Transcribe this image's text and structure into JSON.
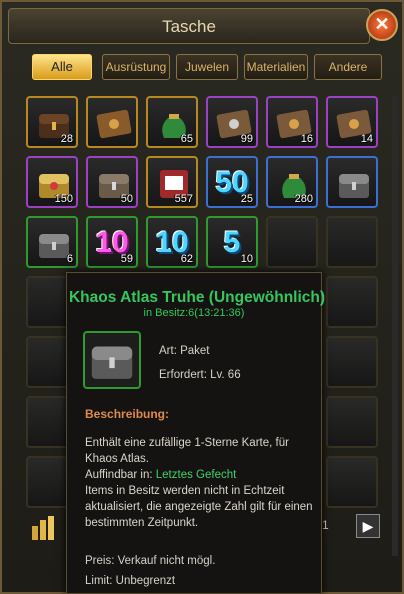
{
  "window": {
    "title": "Tasche",
    "close_symbol": "✕"
  },
  "tabs": [
    {
      "label": "Alle",
      "active": true
    },
    {
      "label": "Ausrüstung",
      "active": false
    },
    {
      "label": "Juwelen",
      "active": false
    },
    {
      "label": "Materialien",
      "active": false
    },
    {
      "label": "Andere",
      "active": false
    }
  ],
  "inventory": {
    "rows": [
      [
        {
          "icon": "treasure-chest-icon",
          "quality": "gold",
          "count": "28"
        },
        {
          "icon": "card-pack-icon",
          "quality": "gold",
          "count": ""
        },
        {
          "icon": "green-pouch-icon",
          "quality": "gold",
          "count": "65"
        },
        {
          "icon": "card-pack-icon",
          "quality": "purple",
          "count": "99"
        },
        {
          "icon": "card-pack-icon",
          "quality": "purple",
          "count": "16"
        },
        {
          "icon": "card-pack-icon",
          "quality": "purple",
          "count": "14"
        }
      ],
      [
        {
          "icon": "golden-chest-icon",
          "quality": "purple",
          "count": "150"
        },
        {
          "icon": "treasure-chest-icon",
          "quality": "purple",
          "count": "50"
        },
        {
          "icon": "playing-cards-icon",
          "quality": "gold",
          "count": "557"
        },
        {
          "icon": "gem-pack-icon",
          "quality": "blue",
          "count": "25",
          "badge": "50"
        },
        {
          "icon": "green-pouch-icon",
          "quality": "blue",
          "count": "280"
        },
        {
          "icon": "silver-chest-icon",
          "quality": "blue",
          "count": ""
        }
      ],
      [
        {
          "icon": "silver-chest-icon",
          "quality": "green",
          "count": "6"
        },
        {
          "icon": "gem-pack-icon",
          "quality": "green",
          "count": "59",
          "badge": "10"
        },
        {
          "icon": "gem-pack-icon",
          "quality": "green",
          "count": "62",
          "badge": "10"
        },
        {
          "icon": "gem-pack-icon",
          "quality": "green",
          "count": "10",
          "badge": "5"
        },
        {
          "icon": "empty-slot",
          "quality": "none",
          "count": ""
        },
        {
          "icon": "empty-slot",
          "quality": "none",
          "count": ""
        }
      ]
    ],
    "pager": {
      "current": "1/1"
    }
  },
  "tooltip": {
    "title": "Khaos Atlas Truhe (Ungewöhnlich)",
    "owned": "in Besitz:6(13:21:36)",
    "type": "Art: Paket",
    "requires": "Erfordert: Lv. 66",
    "section": "Beschreibung:",
    "desc_1": "Enthält eine zufällige 1-Sterne Karte, für Khaos Atlas.",
    "found_prefix": "Auffindbar in: ",
    "found_link": "Letztes Gefecht",
    "desc_2": "Items in Besitz werden nicht in Echtzeit aktualisiert, die angezeigte Zahl gilt für einen bestimmten Zeitpunkt.",
    "price": "Preis: Verkauf nicht mögl.",
    "limit": "Limit: Unbegrenzt"
  }
}
